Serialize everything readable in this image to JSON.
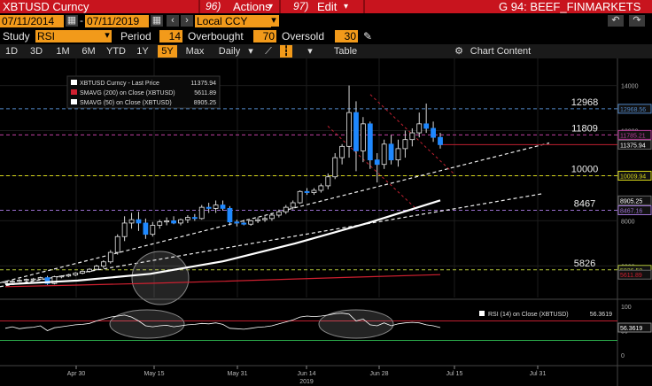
{
  "header": {
    "ticker": "XBTUSD Curncy",
    "actions_num": "96)",
    "actions_label": "Actions",
    "edit_num": "97)",
    "edit_label": "Edit",
    "page_code": "G 94: BEEF_FINMARKETS"
  },
  "range": {
    "start_date": "07/11/2014",
    "end_date": "07/11/2019",
    "currency": "Local CCY"
  },
  "study": {
    "label": "Study",
    "value": "RSI",
    "period_label": "Period",
    "period_value": "14",
    "overbought_label": "Overbought",
    "overbought_value": "70",
    "oversold_label": "Oversold",
    "oversold_value": "30"
  },
  "toolbar": {
    "timeframes": [
      "1D",
      "3D",
      "1M",
      "6M",
      "YTD",
      "1Y",
      "5Y",
      "Max"
    ],
    "active_timeframe": "5Y",
    "frequency": "Daily",
    "table_label": "Table",
    "chart_content_label": "Chart Content"
  },
  "chart_data": {
    "type": "candlestick",
    "legend": [
      {
        "name": "XBTUSD Curncy - Last Price",
        "value": "11375.94",
        "color": "#ffffff"
      },
      {
        "name": "SMAVG (200) on Close (XBTUSD)",
        "value": "5611.89",
        "color": "#d02030"
      },
      {
        "name": "SMAVG (50) on Close (XBTUSD)",
        "value": "8905.25",
        "color": "#ffffff"
      }
    ],
    "x_ticks": [
      "Apr 30",
      "May 15",
      "May 31",
      "Jun 14",
      "Jun 28",
      "Jul 15",
      "Jul 31"
    ],
    "x_year": "2019",
    "y_ticks": [
      "14000",
      "12000",
      "10000",
      "8000",
      "6000"
    ],
    "levels": [
      {
        "value": "12968",
        "tag": "12968.56",
        "color": "#4f86c6"
      },
      {
        "value": "11809",
        "tag": "11785.21",
        "color": "#c03fa0"
      },
      {
        "value": "10000",
        "tag": "10009.94",
        "color": "#d8d81a"
      },
      {
        "value": "8467",
        "tag": "8467.16",
        "color": "#9a6fd0"
      },
      {
        "value": "5826",
        "tag": "5826.50",
        "color": "#b5c83a"
      }
    ],
    "right_tags": [
      {
        "text": "11375.94",
        "color": "#ffffff"
      },
      {
        "text": "8905.25",
        "color": "#ffffff"
      },
      {
        "text": "5611.89",
        "color": "#d02030"
      }
    ],
    "candles": [
      {
        "o": 5280,
        "h": 5350,
        "l": 5210,
        "c": 5300
      },
      {
        "o": 5300,
        "h": 5380,
        "l": 5250,
        "c": 5320
      },
      {
        "o": 5320,
        "h": 5420,
        "l": 5280,
        "c": 5360
      },
      {
        "o": 5360,
        "h": 5440,
        "l": 5300,
        "c": 5400
      },
      {
        "o": 5400,
        "h": 5470,
        "l": 5350,
        "c": 5420
      },
      {
        "o": 5420,
        "h": 5520,
        "l": 5380,
        "c": 5480
      },
      {
        "o": 5480,
        "h": 5560,
        "l": 5160,
        "c": 5220
      },
      {
        "o": 5220,
        "h": 5560,
        "l": 5180,
        "c": 5520
      },
      {
        "o": 5520,
        "h": 5580,
        "l": 5450,
        "c": 5550
      },
      {
        "o": 5550,
        "h": 5650,
        "l": 5500,
        "c": 5600
      },
      {
        "o": 5600,
        "h": 5720,
        "l": 5550,
        "c": 5680
      },
      {
        "o": 5680,
        "h": 5800,
        "l": 5630,
        "c": 5760
      },
      {
        "o": 5760,
        "h": 5900,
        "l": 5700,
        "c": 5850
      },
      {
        "o": 5850,
        "h": 6050,
        "l": 5800,
        "c": 5990
      },
      {
        "o": 5990,
        "h": 6250,
        "l": 5900,
        "c": 6180
      },
      {
        "o": 6180,
        "h": 6700,
        "l": 6100,
        "c": 6600
      },
      {
        "o": 6600,
        "h": 7400,
        "l": 6500,
        "c": 7300
      },
      {
        "o": 7300,
        "h": 8200,
        "l": 7100,
        "c": 7900
      },
      {
        "o": 7900,
        "h": 8350,
        "l": 7650,
        "c": 8050
      },
      {
        "o": 8050,
        "h": 8400,
        "l": 7550,
        "c": 7900
      },
      {
        "o": 7900,
        "h": 8100,
        "l": 7200,
        "c": 7400
      },
      {
        "o": 7400,
        "h": 7950,
        "l": 7300,
        "c": 7800
      },
      {
        "o": 7800,
        "h": 8050,
        "l": 7650,
        "c": 7950
      },
      {
        "o": 7950,
        "h": 8150,
        "l": 7800,
        "c": 8000
      },
      {
        "o": 8000,
        "h": 8200,
        "l": 7850,
        "c": 7900
      },
      {
        "o": 7900,
        "h": 8100,
        "l": 7800,
        "c": 8050
      },
      {
        "o": 8050,
        "h": 8250,
        "l": 7900,
        "c": 8150
      },
      {
        "o": 8150,
        "h": 8300,
        "l": 8000,
        "c": 8100
      },
      {
        "o": 8100,
        "h": 8700,
        "l": 8050,
        "c": 8600
      },
      {
        "o": 8600,
        "h": 8800,
        "l": 8350,
        "c": 8550
      },
      {
        "o": 8550,
        "h": 8900,
        "l": 8350,
        "c": 8700
      },
      {
        "o": 8700,
        "h": 8900,
        "l": 8450,
        "c": 8550
      },
      {
        "o": 8550,
        "h": 8650,
        "l": 7800,
        "c": 7950
      },
      {
        "o": 7950,
        "h": 8050,
        "l": 7750,
        "c": 7900
      },
      {
        "o": 7900,
        "h": 8050,
        "l": 7800,
        "c": 7850
      },
      {
        "o": 7850,
        "h": 8050,
        "l": 7780,
        "c": 8000
      },
      {
        "o": 8000,
        "h": 8150,
        "l": 7900,
        "c": 8050
      },
      {
        "o": 8050,
        "h": 8200,
        "l": 7950,
        "c": 8100
      },
      {
        "o": 8100,
        "h": 8350,
        "l": 8000,
        "c": 8250
      },
      {
        "o": 8250,
        "h": 8500,
        "l": 8150,
        "c": 8400
      },
      {
        "o": 8400,
        "h": 8700,
        "l": 8300,
        "c": 8600
      },
      {
        "o": 8600,
        "h": 8900,
        "l": 8500,
        "c": 8800
      },
      {
        "o": 8800,
        "h": 9350,
        "l": 8750,
        "c": 9300
      },
      {
        "o": 9300,
        "h": 9450,
        "l": 9150,
        "c": 9250
      },
      {
        "o": 9250,
        "h": 9450,
        "l": 9150,
        "c": 9350
      },
      {
        "o": 9350,
        "h": 9650,
        "l": 9250,
        "c": 9550
      },
      {
        "o": 9550,
        "h": 10100,
        "l": 9400,
        "c": 9950
      },
      {
        "o": 9950,
        "h": 11000,
        "l": 9850,
        "c": 10800
      },
      {
        "o": 10800,
        "h": 11400,
        "l": 10500,
        "c": 11300
      },
      {
        "o": 11300,
        "h": 14000,
        "l": 10800,
        "c": 12800
      },
      {
        "o": 12800,
        "h": 13300,
        "l": 10200,
        "c": 11100
      },
      {
        "o": 11100,
        "h": 12600,
        "l": 10600,
        "c": 12300
      },
      {
        "o": 12300,
        "h": 12400,
        "l": 10300,
        "c": 10700
      },
      {
        "o": 10700,
        "h": 11000,
        "l": 9700,
        "c": 10500
      },
      {
        "o": 10500,
        "h": 11600,
        "l": 10300,
        "c": 11400
      },
      {
        "o": 11400,
        "h": 11800,
        "l": 10500,
        "c": 10700
      },
      {
        "o": 10700,
        "h": 11600,
        "l": 10400,
        "c": 11200
      },
      {
        "o": 11200,
        "h": 12000,
        "l": 10800,
        "c": 11600
      },
      {
        "o": 11600,
        "h": 12100,
        "l": 11300,
        "c": 11900
      },
      {
        "o": 11900,
        "h": 12800,
        "l": 11700,
        "c": 12300
      },
      {
        "o": 12300,
        "h": 13200,
        "l": 11900,
        "c": 12100
      },
      {
        "o": 12100,
        "h": 12400,
        "l": 11500,
        "c": 11700
      },
      {
        "o": 11700,
        "h": 11900,
        "l": 11200,
        "c": 11376
      }
    ],
    "sma200": [
      5080,
      5150,
      5230,
      5320,
      5420,
      5520,
      5611.89
    ],
    "sma50": [
      5180,
      5350,
      5650,
      6200,
      7000,
      7900,
      8905.25
    ],
    "rsi": {
      "label": "RSI (14)  on Close (XBTUSD)",
      "last": "56.3619",
      "overbought": 70,
      "oversold": 30,
      "y_ticks": [
        "100",
        "50",
        "0"
      ]
    }
  }
}
